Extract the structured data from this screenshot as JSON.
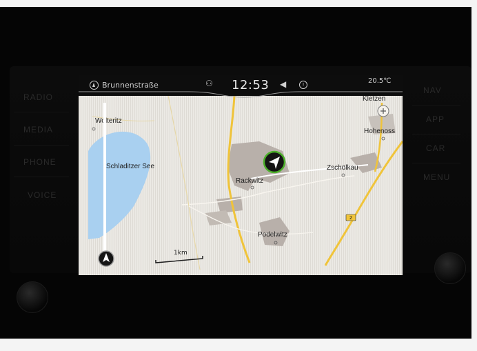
{
  "side_buttons_left": [
    "RADIO",
    "MEDIA",
    "PHONE",
    "VOICE"
  ],
  "side_buttons_right": [
    "NAV",
    "APP",
    "CAR",
    "MENU"
  ],
  "status": {
    "street": "Brunnenstraße",
    "time": "12:53",
    "temperature": "20.5℃"
  },
  "map": {
    "places": {
      "wolteritz": "Wolteritz",
      "lake": "Schladitzer See",
      "rackwitz": "Rackwitz",
      "zscholkau": "Zschölkau",
      "podelwitz": "Podelwitz",
      "kletzen": "Kletzen",
      "hohenoss": "Hohenoss"
    },
    "road_number": "2",
    "scale_label": "1km"
  },
  "colors": {
    "land": "#e9e7e2",
    "water": "#a9d0f0",
    "urban": "#b8b0aa",
    "road_major": "#f0c43a",
    "position_accent": "#4caf2a"
  },
  "icons": [
    "compass-icon",
    "traffic-icon",
    "mute-icon",
    "info-icon",
    "navigation-arrow-icon",
    "north-arrow-icon"
  ]
}
